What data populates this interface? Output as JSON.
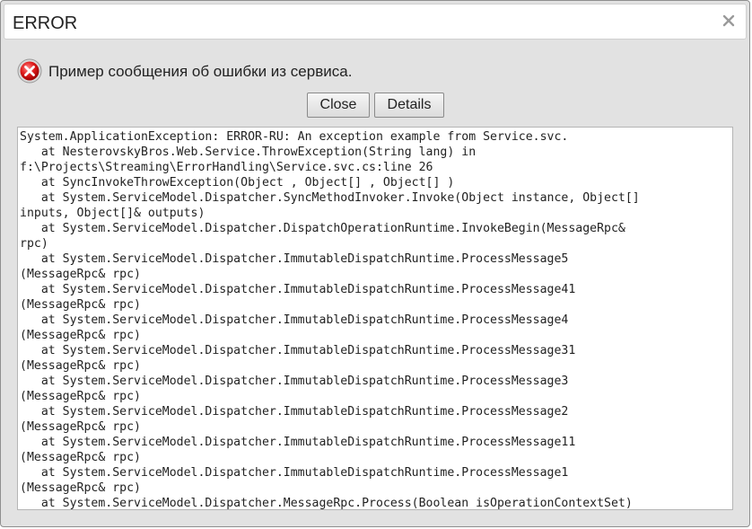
{
  "dialog": {
    "title": "ERROR",
    "close_icon": "close-icon",
    "message_icon": "error-icon",
    "message": "Пример сообщения об ошибки из сервиса.",
    "buttons": {
      "close": "Close",
      "details": "Details"
    },
    "trace_lines": [
      "System.ApplicationException: ERROR-RU: An exception example from Service.svc.",
      "   at NesterovskyBros.Web.Service.ThrowException(String lang) in",
      "f:\\Projects\\Streaming\\ErrorHandling\\Service.svc.cs:line 26",
      "   at SyncInvokeThrowException(Object , Object[] , Object[] )",
      "   at System.ServiceModel.Dispatcher.SyncMethodInvoker.Invoke(Object instance, Object[]",
      "inputs, Object[]& outputs)",
      "   at System.ServiceModel.Dispatcher.DispatchOperationRuntime.InvokeBegin(MessageRpc&",
      "rpc)",
      "   at System.ServiceModel.Dispatcher.ImmutableDispatchRuntime.ProcessMessage5",
      "(MessageRpc& rpc)",
      "   at System.ServiceModel.Dispatcher.ImmutableDispatchRuntime.ProcessMessage41",
      "(MessageRpc& rpc)",
      "   at System.ServiceModel.Dispatcher.ImmutableDispatchRuntime.ProcessMessage4",
      "(MessageRpc& rpc)",
      "   at System.ServiceModel.Dispatcher.ImmutableDispatchRuntime.ProcessMessage31",
      "(MessageRpc& rpc)",
      "   at System.ServiceModel.Dispatcher.ImmutableDispatchRuntime.ProcessMessage3",
      "(MessageRpc& rpc)",
      "   at System.ServiceModel.Dispatcher.ImmutableDispatchRuntime.ProcessMessage2",
      "(MessageRpc& rpc)",
      "   at System.ServiceModel.Dispatcher.ImmutableDispatchRuntime.ProcessMessage11",
      "(MessageRpc& rpc)",
      "   at System.ServiceModel.Dispatcher.ImmutableDispatchRuntime.ProcessMessage1",
      "(MessageRpc& rpc)",
      "   at System.ServiceModel.Dispatcher.MessageRpc.Process(Boolean isOperationContextSet)"
    ]
  }
}
